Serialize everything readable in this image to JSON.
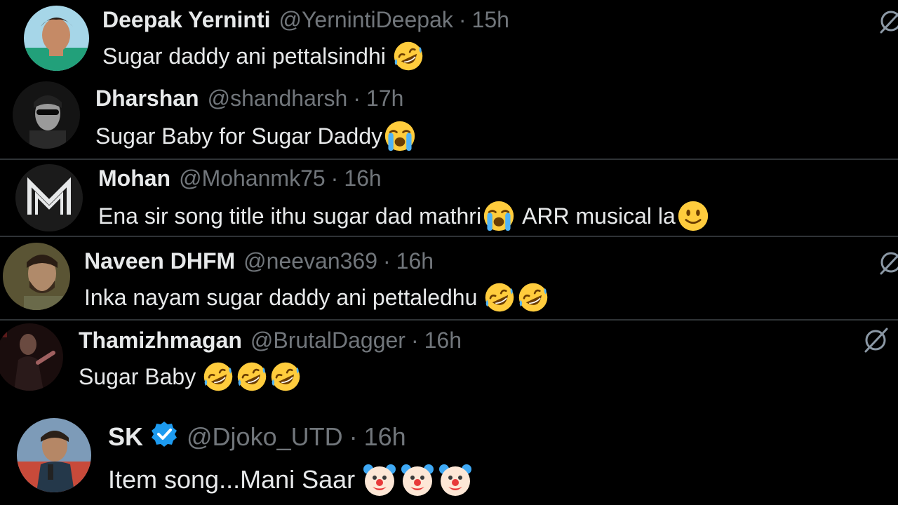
{
  "colors": {
    "background": "#000000",
    "primary_text": "#e7e9ea",
    "secondary_text": "#71767b",
    "divider": "#2f3336",
    "verified": "#1d9bf0"
  },
  "replies": [
    {
      "name": "Deepak Yerninti",
      "handle": "@YernintiDeepak",
      "separator": "·",
      "time": "15h",
      "text": "Sugar daddy ani pettalsindhi",
      "emojis": [
        "rofl"
      ],
      "avatar": "photo-avatar-green-shirt"
    },
    {
      "name": "Dharshan",
      "handle": "@shandharsh",
      "separator": "·",
      "time": "17h",
      "text": "Sugar Baby for Sugar Daddy",
      "emojis": [
        "loudly-crying"
      ],
      "avatar": "photo-avatar-sunglasses"
    },
    {
      "name": "Mohan",
      "handle": "@Mohanmk75",
      "separator": "·",
      "time": "16h",
      "text": "Ena sir song title ithu sugar dad mathri",
      "text2": "ARR musical la",
      "emojis": [
        "loudly-crying",
        "slightly-smiling"
      ],
      "avatar": "logo-avatar-m"
    },
    {
      "name": "Naveen DHFM",
      "handle": "@neevan369",
      "separator": "·",
      "time": "16h",
      "text": "Inka nayam sugar daddy ani pettaledhu",
      "emojis": [
        "rofl",
        "rofl"
      ],
      "avatar": "photo-avatar-bearded"
    },
    {
      "name": "Thamizhmagan",
      "handle": "@BrutalDagger",
      "separator": "·",
      "time": "16h",
      "text": "Sugar Baby",
      "emojis": [
        "rofl",
        "rofl",
        "rofl"
      ],
      "avatar": "photo-avatar-stage"
    },
    {
      "name": "SK",
      "handle": "@Djoko_UTD",
      "separator": "·",
      "time": "16h",
      "text": "Item song...Mani Saar",
      "emojis": [
        "clown",
        "clown",
        "clown"
      ],
      "verified": true,
      "avatar": "photo-avatar-mic"
    }
  ],
  "icons": {
    "grok": "grok-icon",
    "verified": "verified-badge-icon"
  }
}
